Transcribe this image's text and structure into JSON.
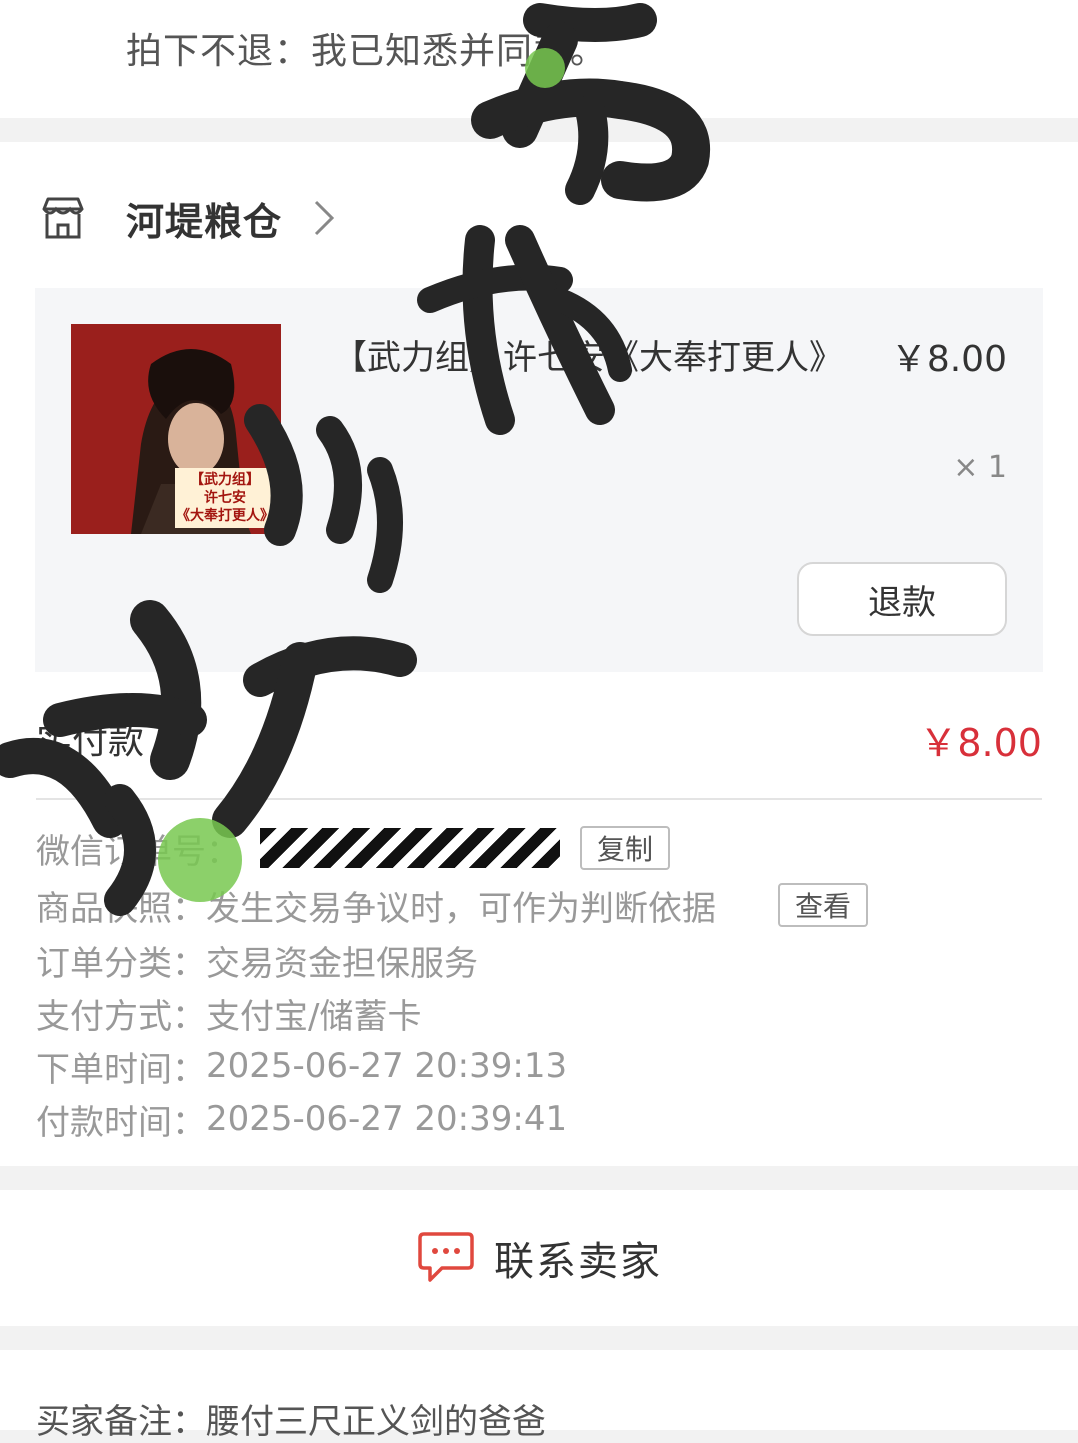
{
  "top": {
    "notice": "拍下不退：我已知悉并同意。"
  },
  "shop": {
    "name": "河堤粮仓",
    "icon": "store-icon",
    "chevron": "chevron-right-icon"
  },
  "item": {
    "title": "【武力组】许七安《大奉打更人》",
    "price": "￥8.00",
    "qty": "× 1",
    "refund_label": "退款",
    "thumb_lines": [
      "【武力组】",
      "许七安",
      "《大奉打更人》"
    ]
  },
  "payment": {
    "label": "实付款",
    "amount": "￥8.00"
  },
  "info": {
    "order_no_label": "微信订单号：",
    "copy_label": "复制",
    "snapshot_label": "商品快照：",
    "snapshot_value": "发生交易争议时，可作为判断依据",
    "view_label": "查看",
    "category_label": "订单分类：",
    "category_value": "交易资金担保服务",
    "pay_method_label": "支付方式：",
    "pay_method_value": "支付宝/储蓄卡",
    "order_time_label": "下单时间：",
    "order_time_value": "2025-06-27 20:39:13",
    "pay_time_label": "付款时间：",
    "pay_time_value": "2025-06-27 20:39:41"
  },
  "contact": {
    "label": "联系卖家",
    "icon": "chat-icon"
  },
  "remark": {
    "text": "买家备注：腰付三尺正义剑的爸爸"
  },
  "colors": {
    "price_red": "#d8303a",
    "brush": "#262626",
    "green_stamp": "#78c850"
  }
}
